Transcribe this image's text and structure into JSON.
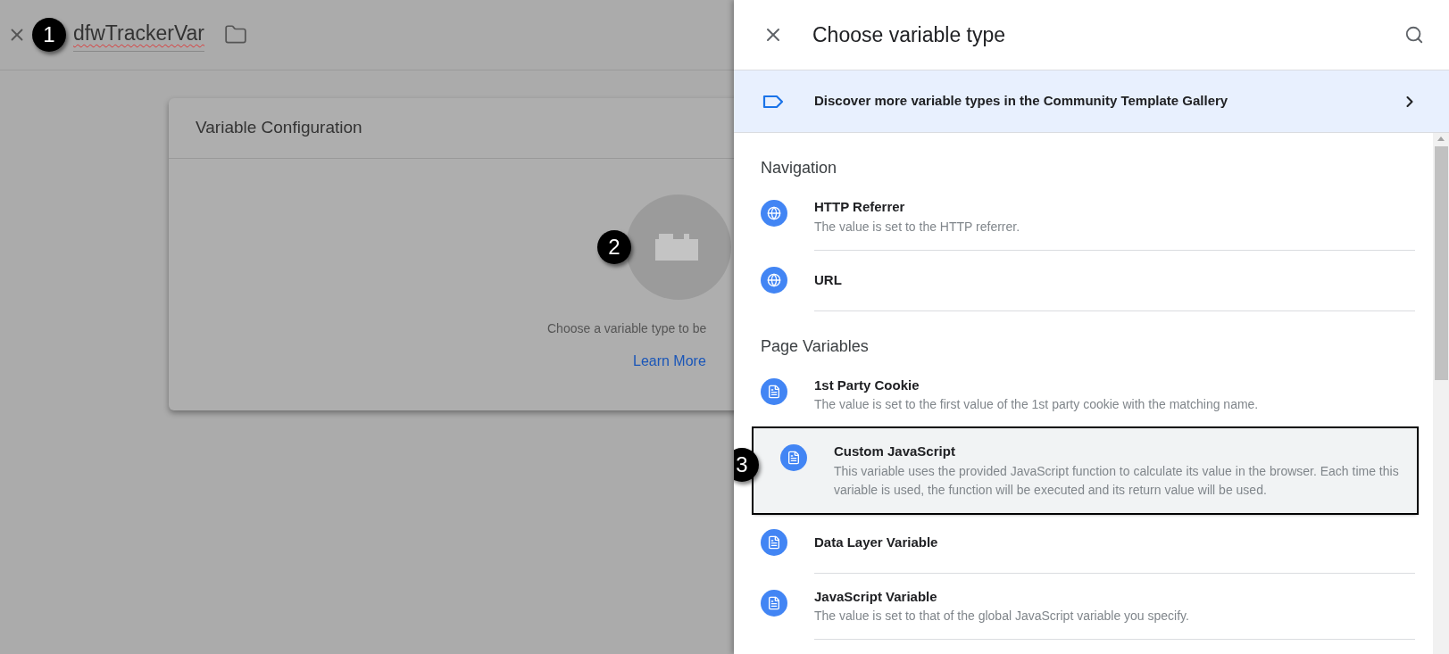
{
  "editor": {
    "title": "dfwTrackerVar",
    "callout": "1"
  },
  "card": {
    "heading": "Variable Configuration",
    "callout": "2",
    "hint": "Choose a variable type to be",
    "link": "Learn More"
  },
  "panel": {
    "title": "Choose variable type",
    "banner": "Discover more variable types in the Community Template Gallery",
    "sections": [
      {
        "heading": "Navigation",
        "items": [
          {
            "kind": "globe",
            "name": "HTTP Referrer",
            "description": "The value is set to the HTTP referrer.",
            "highlighted": false
          },
          {
            "kind": "globe",
            "name": "URL",
            "highlighted": false
          }
        ]
      },
      {
        "heading": "Page Variables",
        "items": [
          {
            "kind": "document",
            "name": "1st Party Cookie",
            "description": "The value is set to the first value of the 1st party cookie with the matching name.",
            "highlighted": false
          },
          {
            "kind": "document",
            "name": "Custom JavaScript",
            "description": "This variable uses the provided JavaScript function to calculate its value in the browser. Each time this variable is used, the function will be executed and its return value will be used.",
            "highlighted": true,
            "callout": "3"
          },
          {
            "kind": "document",
            "name": "Data Layer Variable",
            "highlighted": false
          },
          {
            "kind": "document",
            "name": "JavaScript Variable",
            "description": "The value is set to that of the global JavaScript variable you specify.",
            "highlighted": false
          }
        ]
      }
    ]
  }
}
